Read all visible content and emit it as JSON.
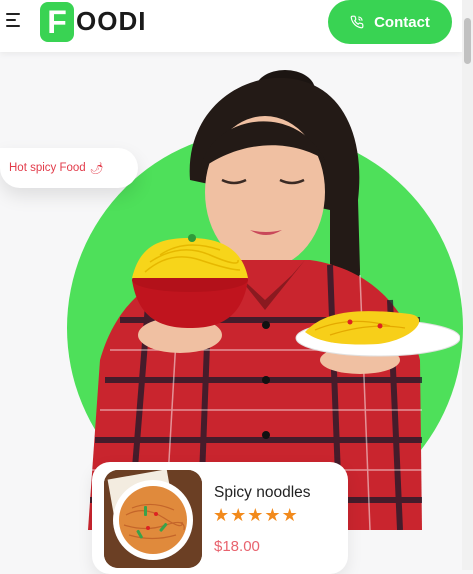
{
  "header": {
    "logo_letter": "F",
    "logo_rest": "OODI",
    "contact_label": "Contact"
  },
  "hero": {
    "tag_text": "Hot spicy Food",
    "tag_icon": "chili-pepper-icon"
  },
  "product_card": {
    "name": "Spicy noodles",
    "rating": 5,
    "rating_max": 5,
    "price": "$18.00"
  },
  "colors": {
    "brand_green": "#39d353",
    "circle_green": "#4ee05a",
    "accent_red": "#e23b4a",
    "star_orange": "#f28a1c"
  }
}
